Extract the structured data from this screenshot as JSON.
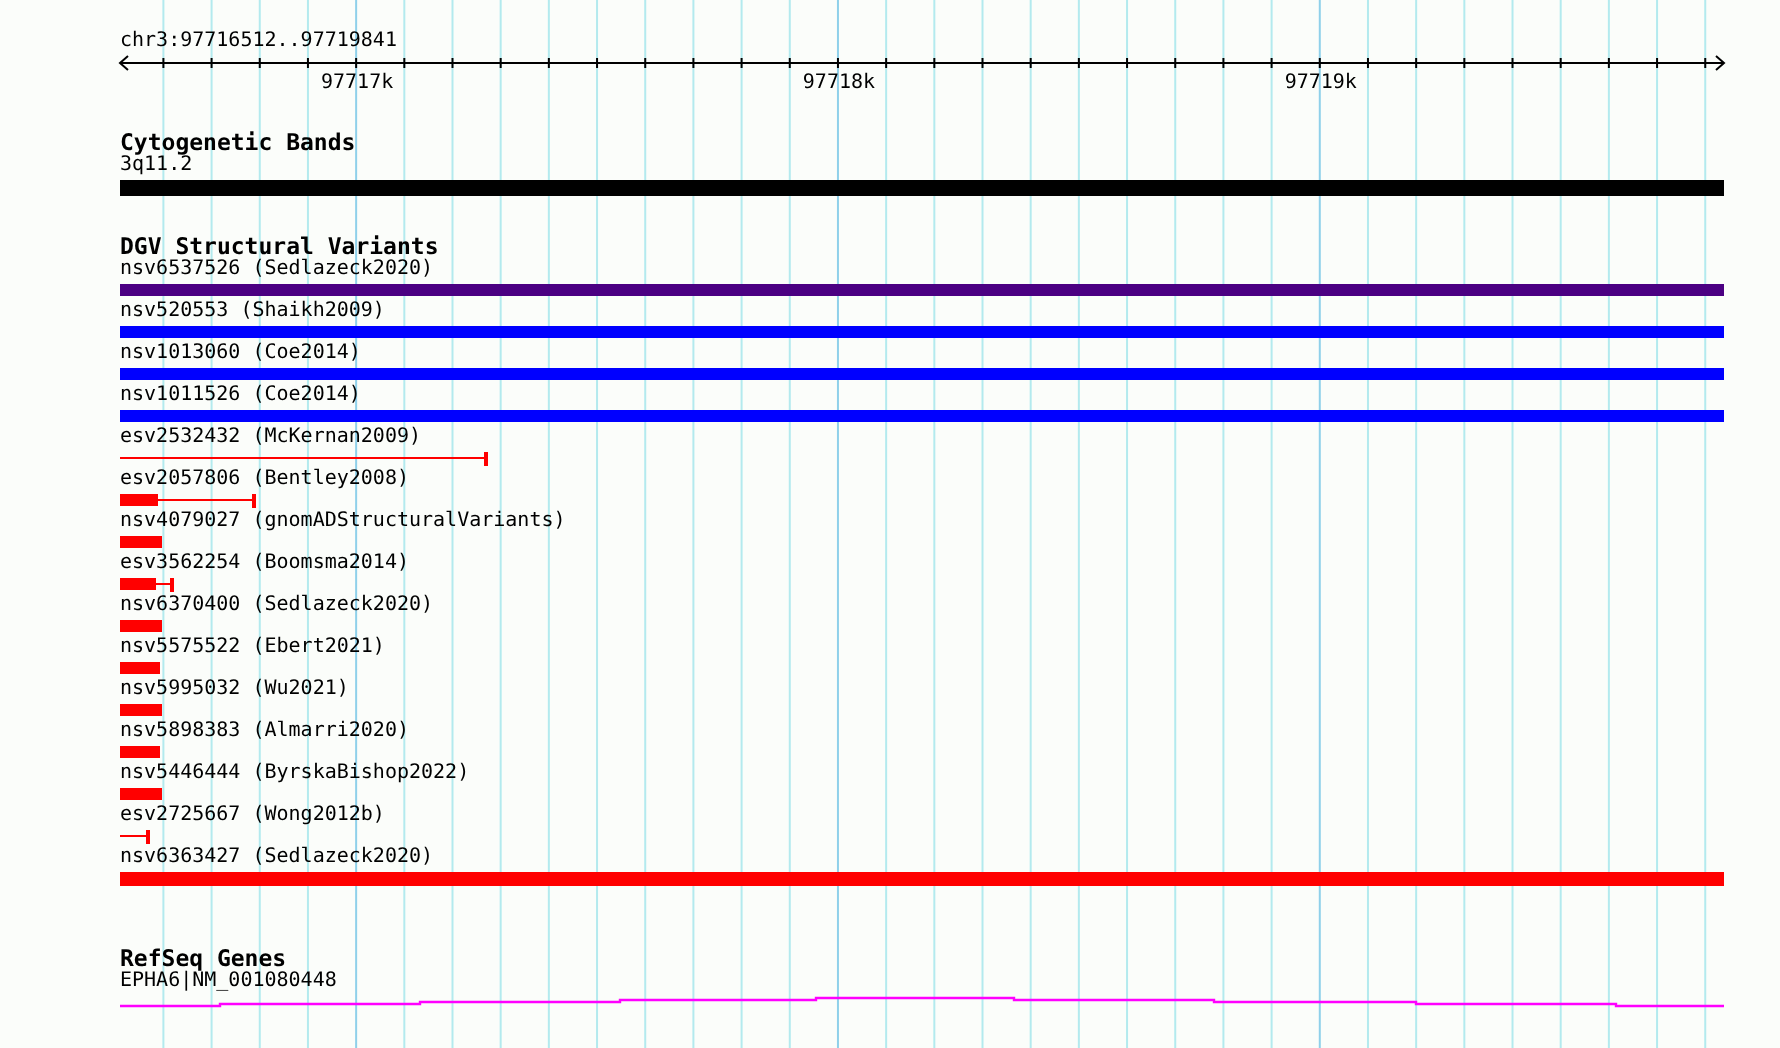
{
  "location": "chr3:97716512..97719841",
  "ruler": {
    "ticks": [
      "97717k",
      "97718k",
      "97719k"
    ]
  },
  "tracks": [
    {
      "kind": "cytoband",
      "title": "Cytogenetic Bands",
      "features": [
        {
          "label": "3q11.2",
          "color": "#000000"
        }
      ]
    },
    {
      "kind": "variants",
      "title": "DGV Structural Variants",
      "features": [
        {
          "label": "nsv6537526 (Sedlazeck2020)",
          "color": "#4b0082"
        },
        {
          "label": "nsv520553 (Shaikh2009)",
          "color": "#0000ff"
        },
        {
          "label": "nsv1013060 (Coe2014)",
          "color": "#0000ff"
        },
        {
          "label": "nsv1011526 (Coe2014)",
          "color": "#0000ff"
        },
        {
          "label": "esv2532432 (McKernan2009)",
          "color": "#ff0000"
        },
        {
          "label": "esv2057806 (Bentley2008)",
          "color": "#ff0000"
        },
        {
          "label": "nsv4079027 (gnomADStructuralVariants)",
          "color": "#ff0000"
        },
        {
          "label": "esv3562254 (Boomsma2014)",
          "color": "#ff0000"
        },
        {
          "label": "nsv6370400 (Sedlazeck2020)",
          "color": "#ff0000"
        },
        {
          "label": "nsv5575522 (Ebert2021)",
          "color": "#ff0000"
        },
        {
          "label": "nsv5995032 (Wu2021)",
          "color": "#ff0000"
        },
        {
          "label": "nsv5898383 (Almarri2020)",
          "color": "#ff0000"
        },
        {
          "label": "nsv5446444 (ByrskaBishop2022)",
          "color": "#ff0000"
        },
        {
          "label": "esv2725667 (Wong2012b)",
          "color": "#ff0000"
        },
        {
          "label": "nsv6363427 (Sedlazeck2020)",
          "color": "#ff0000"
        }
      ]
    },
    {
      "kind": "gene",
      "title": "RefSeq Genes",
      "features": [
        {
          "label": "EPHA6|NM_001080448",
          "color": "#ff00ff"
        }
      ]
    }
  ]
}
